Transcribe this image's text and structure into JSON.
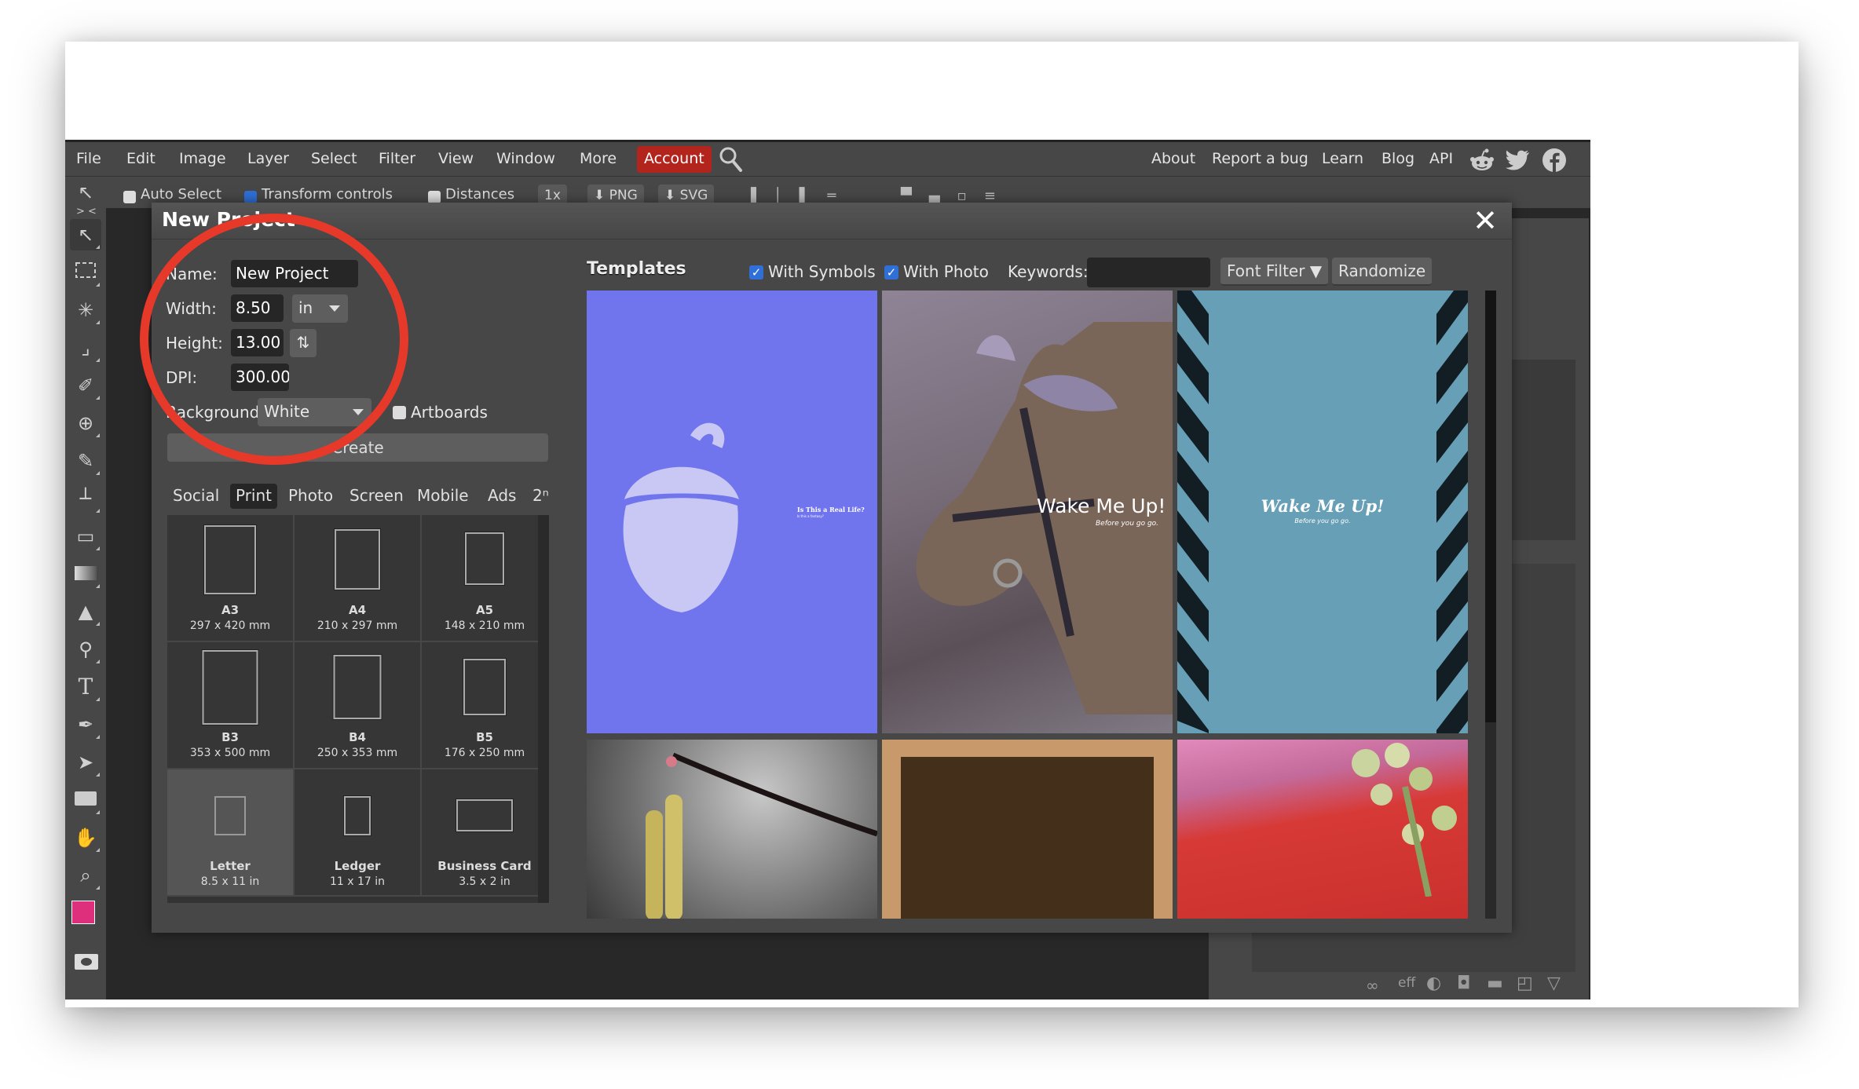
{
  "menu": {
    "left_items": [
      "File",
      "Edit",
      "Image",
      "Layer",
      "Select",
      "Filter",
      "View",
      "Window",
      "More"
    ],
    "account_label": "Account",
    "right_items": [
      "About",
      "Report a bug",
      "Learn",
      "Blog",
      "API"
    ],
    "social_icons": [
      "reddit-icon",
      "twitter-icon",
      "facebook-icon"
    ],
    "account_color": "#b2241c"
  },
  "toolbar": {
    "auto_select": "Auto Select",
    "transform_controls": "Transform controls",
    "distances": "Distances",
    "zoom": "1x",
    "png": "PNG",
    "svg": "SVG"
  },
  "tools": [
    "move",
    "marquee",
    "magic-wand",
    "crop",
    "eyedropper",
    "healing",
    "brush",
    "stamp",
    "eraser",
    "gradient",
    "blur",
    "dodge",
    "text",
    "pen",
    "path-select",
    "shape",
    "hand",
    "zoom"
  ],
  "colors": {
    "foreground": "#dd2f7b",
    "background": "#ffffff"
  },
  "dialog": {
    "title": "New Project",
    "name_label": "Name:",
    "name_value": "New Project",
    "width_label": "Width:",
    "width_value": "8.50",
    "unit": "in",
    "height_label": "Height:",
    "height_value": "13.00",
    "dpi_label": "DPI:",
    "dpi_value": "300.000",
    "background_label": "Background:",
    "background_value": "White",
    "artboards_label": "Artboards",
    "create_label": "Create",
    "category_tabs": [
      "Social",
      "Print",
      "Photo",
      "Screen",
      "Mobile",
      "Ads",
      "2ⁿ"
    ],
    "active_tab": "Print",
    "presets": [
      {
        "name": "A3",
        "size": "297 x 420 mm"
      },
      {
        "name": "A4",
        "size": "210 x 297 mm"
      },
      {
        "name": "A5",
        "size": "148 x 210 mm"
      },
      {
        "name": "B3",
        "size": "353 x 500 mm"
      },
      {
        "name": "B4",
        "size": "250 x 353 mm"
      },
      {
        "name": "B5",
        "size": "176 x 250 mm"
      },
      {
        "name": "Letter",
        "size": "8.5 x 11 in"
      },
      {
        "name": "Ledger",
        "size": "11 x 17 in"
      },
      {
        "name": "Business Card",
        "size": "3.5 x 2 in"
      }
    ],
    "templates": {
      "heading": "Templates",
      "with_symbols": "With Symbols",
      "with_photo": "With Photo",
      "keywords_label": "Keywords:",
      "keywords_value": "",
      "font_filter": "Font Filter",
      "randomize": "Randomize",
      "items": [
        {
          "title": "Is This a Real Life?",
          "subtitle": "Is this a fantasy?",
          "bg": "#7075ee"
        },
        {
          "title": "Wake Me Up!",
          "subtitle": "Before you go go.",
          "bg": "#6d5f6e"
        },
        {
          "title": "Wake Me Up!",
          "subtitle": "Before you go go.",
          "bg": "#679fb6"
        },
        {
          "title": "",
          "subtitle": "",
          "bg": "#5a5a5a"
        },
        {
          "title": "",
          "subtitle": "",
          "bg": "#c8996b"
        },
        {
          "title": "",
          "subtitle": "",
          "bg": "#d73a36"
        }
      ]
    }
  },
  "layers_footer": {
    "eff_label": "eff"
  }
}
